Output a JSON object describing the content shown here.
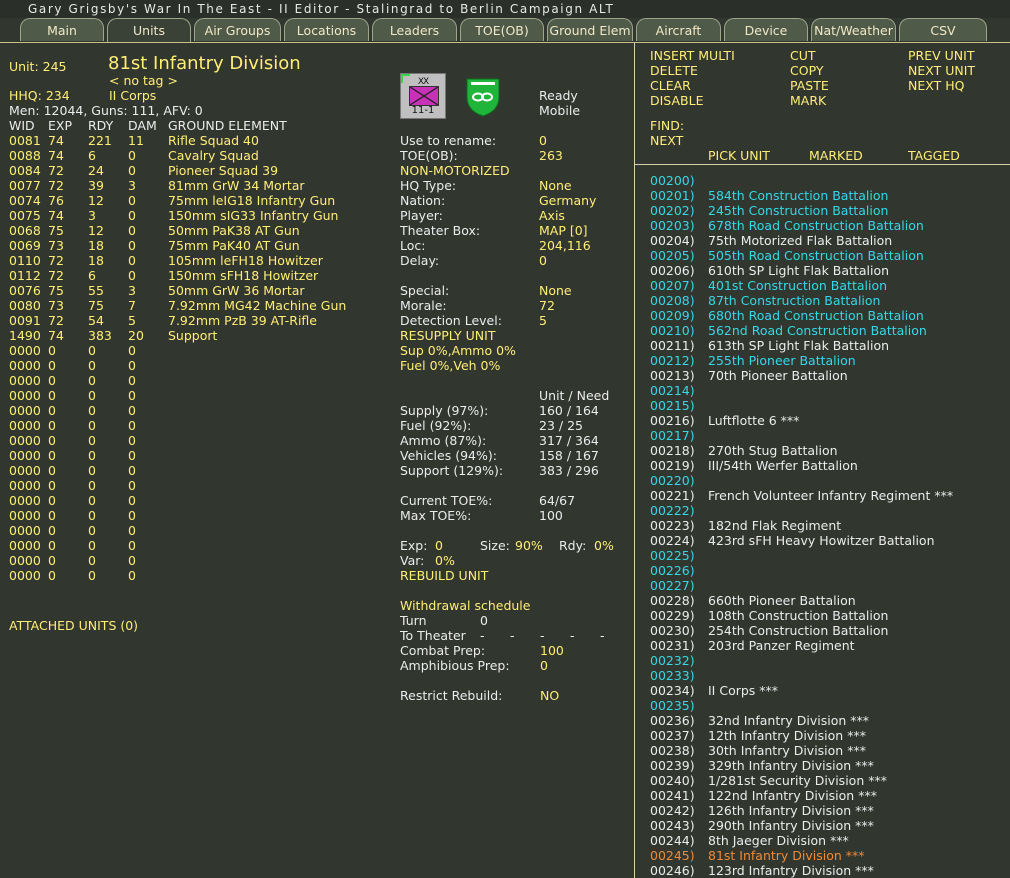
{
  "titlebar": "Gary Grigsby's War In The East - II Editor -  Stalingrad to Berlin Campaign ALT",
  "tabs": [
    "Main",
    "Units",
    "Air Groups",
    "Locations",
    "Leaders",
    "TOE(OB)",
    "Ground Elem",
    "Aircraft",
    "Device",
    "Nat/Weather",
    "CSV"
  ],
  "active_tab": "Units",
  "unit": {
    "unit_label": "Unit: 245",
    "name": "81st Infantry Division",
    "tag": "< no tag >",
    "hhq_label": "HHQ: 234",
    "hhq_name": "II Corps",
    "summary": "Men: 12044, Guns: 111, AFV: 0"
  },
  "elements_header": [
    "WID",
    "EXP",
    "RDY",
    "DAM",
    "GROUND ELEMENT"
  ],
  "elements": [
    [
      "0081",
      "74",
      "221",
      "11",
      "Rifle Squad 40"
    ],
    [
      "0088",
      "74",
      "6",
      "0",
      "Cavalry Squad"
    ],
    [
      "0084",
      "72",
      "24",
      "0",
      "Pioneer Squad 39"
    ],
    [
      "0077",
      "72",
      "39",
      "3",
      "81mm GrW 34 Mortar"
    ],
    [
      "0074",
      "76",
      "12",
      "0",
      "75mm leIG18 Infantry Gun"
    ],
    [
      "0075",
      "74",
      "3",
      "0",
      "150mm sIG33 Infantry Gun"
    ],
    [
      "0068",
      "75",
      "12",
      "0",
      "50mm PaK38 AT Gun"
    ],
    [
      "0069",
      "73",
      "18",
      "0",
      "75mm PaK40 AT Gun"
    ],
    [
      "0110",
      "72",
      "18",
      "0",
      "105mm leFH18 Howitzer"
    ],
    [
      "0112",
      "72",
      "6",
      "0",
      "150mm sFH18 Howitzer"
    ],
    [
      "0076",
      "75",
      "55",
      "3",
      "50mm GrW 36 Mortar"
    ],
    [
      "0080",
      "73",
      "75",
      "7",
      "7.92mm MG42 Machine Gun"
    ],
    [
      "0091",
      "72",
      "54",
      "5",
      "7.92mm PzB 39 AT-Rifle"
    ],
    [
      "1490",
      "74",
      "383",
      "20",
      "Support"
    ],
    [
      "0000",
      "0",
      "0",
      "0",
      ""
    ],
    [
      "0000",
      "0",
      "0",
      "0",
      ""
    ],
    [
      "0000",
      "0",
      "0",
      "0",
      ""
    ],
    [
      "0000",
      "0",
      "0",
      "0",
      ""
    ],
    [
      "0000",
      "0",
      "0",
      "0",
      ""
    ],
    [
      "0000",
      "0",
      "0",
      "0",
      ""
    ],
    [
      "0000",
      "0",
      "0",
      "0",
      ""
    ],
    [
      "0000",
      "0",
      "0",
      "0",
      ""
    ],
    [
      "0000",
      "0",
      "0",
      "0",
      ""
    ],
    [
      "0000",
      "0",
      "0",
      "0",
      ""
    ],
    [
      "0000",
      "0",
      "0",
      "0",
      ""
    ],
    [
      "0000",
      "0",
      "0",
      "0",
      ""
    ],
    [
      "0000",
      "0",
      "0",
      "0",
      ""
    ],
    [
      "0000",
      "0",
      "0",
      "0",
      ""
    ],
    [
      "0000",
      "0",
      "0",
      "0",
      ""
    ],
    [
      "0000",
      "0",
      "0",
      "0",
      ""
    ]
  ],
  "attached_units": "ATTACHED UNITS (0)",
  "counter": {
    "type": "XX",
    "number": "11-1"
  },
  "status": {
    "ready": "Ready",
    "mobile": "Mobile"
  },
  "props": [
    {
      "k": "Use to rename:",
      "v": "0"
    },
    {
      "k": "TOE(OB):",
      "v": "263"
    },
    {
      "k": "NON-MOTORIZED",
      "v": ""
    },
    {
      "k": "HQ Type:",
      "v": "None"
    },
    {
      "k": "Nation:",
      "v": "Germany"
    },
    {
      "k": "Player:",
      "v": "Axis"
    },
    {
      "k": "Theater Box:",
      "v": "MAP [0]"
    },
    {
      "k": "Loc:",
      "v": "204,116"
    },
    {
      "k": "Delay:",
      "v": "0"
    },
    {
      "k": "",
      "v": ""
    },
    {
      "k": "Special:",
      "v": "None"
    },
    {
      "k": "Morale:",
      "v": "72"
    },
    {
      "k": "Detection Level:",
      "v": "5"
    },
    {
      "k": "RESUPPLY UNIT",
      "v": ""
    },
    {
      "k": "Sup 0%,Ammo 0%",
      "v": ""
    },
    {
      "k": "Fuel 0%,Veh 0%",
      "v": ""
    }
  ],
  "supply_header": "Unit / Need",
  "supply": [
    {
      "k": "Supply (97%):",
      "v": "160 / 164"
    },
    {
      "k": "Fuel (92%):",
      "v": "23 / 25"
    },
    {
      "k": "Ammo (87%):",
      "v": "317 / 364"
    },
    {
      "k": "Vehicles (94%):",
      "v": "158 / 167"
    },
    {
      "k": "Support (129%):",
      "v": "383 / 296"
    }
  ],
  "toe": [
    {
      "k": "Current TOE%:",
      "v": "64/67"
    },
    {
      "k": "Max TOE%:",
      "v": "100"
    }
  ],
  "exp_line": {
    "exp_label": "Exp:",
    "exp": "0",
    "size_label": "Size:",
    "size": "90%",
    "rdy_label": "Rdy:",
    "rdy": "0%",
    "var_label": "Var:",
    "var": "0%"
  },
  "rebuild_unit": "REBUILD UNIT",
  "withdrawal": {
    "title": "Withdrawal schedule",
    "turn_label": "Turn",
    "turn": "0",
    "theater_label": "To Theater",
    "theater_dashes": [
      "-",
      "-",
      "-",
      "-",
      "-"
    ],
    "combat_label": "Combat Prep:",
    "combat": "100",
    "amph_label": "Amphibious Prep:",
    "amph": "0",
    "restrict_label": "Restrict Rebuild:",
    "restrict": "NO"
  },
  "commands": {
    "col1": [
      "INSERT MULTI",
      "DELETE",
      "CLEAR",
      "DISABLE"
    ],
    "col2": [
      "CUT",
      "COPY",
      "PASTE",
      "MARK"
    ],
    "col3": [
      "PREV UNIT",
      "NEXT UNIT",
      "NEXT HQ"
    ],
    "find": "FIND:",
    "next": "NEXT"
  },
  "list_headers": [
    "PICK UNIT",
    "MARKED",
    "TAGGED"
  ],
  "unit_list": [
    {
      "id": "00200)",
      "name": "",
      "c": "c"
    },
    {
      "id": "00201)",
      "name": "584th Construction Battalion",
      "c": "c"
    },
    {
      "id": "00202)",
      "name": "245th Construction Battalion",
      "c": "c"
    },
    {
      "id": "00203)",
      "name": "678th Road Construction Battalion",
      "c": "c"
    },
    {
      "id": "00204)",
      "name": "75th Motorized Flak Battalion",
      "c": "w"
    },
    {
      "id": "00205)",
      "name": "505th Road Construction Battalion",
      "c": "c"
    },
    {
      "id": "00206)",
      "name": "610th SP Light Flak Battalion",
      "c": "w"
    },
    {
      "id": "00207)",
      "name": "401st Construction Battalion",
      "c": "c"
    },
    {
      "id": "00208)",
      "name": "87th Construction Battalion",
      "c": "c"
    },
    {
      "id": "00209)",
      "name": "680th Road Construction Battalion",
      "c": "c"
    },
    {
      "id": "00210)",
      "name": "562nd Road Construction Battalion",
      "c": "c"
    },
    {
      "id": "00211)",
      "name": "613th SP Light Flak Battalion",
      "c": "w"
    },
    {
      "id": "00212)",
      "name": "255th Pioneer Battalion",
      "c": "c"
    },
    {
      "id": "00213)",
      "name": "70th Pioneer Battalion",
      "c": "w"
    },
    {
      "id": "00214)",
      "name": "",
      "c": "c"
    },
    {
      "id": "00215)",
      "name": "",
      "c": "c"
    },
    {
      "id": "00216)",
      "name": "Luftflotte 6  ***",
      "c": "w"
    },
    {
      "id": "00217)",
      "name": "",
      "c": "c"
    },
    {
      "id": "00218)",
      "name": "270th Stug Battalion",
      "c": "w"
    },
    {
      "id": "00219)",
      "name": "III/54th Werfer Battalion",
      "c": "w"
    },
    {
      "id": "00220)",
      "name": "",
      "c": "c"
    },
    {
      "id": "00221)",
      "name": "French Volunteer Infantry Regiment ***",
      "c": "w"
    },
    {
      "id": "00222)",
      "name": "",
      "c": "c"
    },
    {
      "id": "00223)",
      "name": "182nd Flak Regiment",
      "c": "w"
    },
    {
      "id": "00224)",
      "name": "423rd sFH Heavy Howitzer Battalion",
      "c": "w"
    },
    {
      "id": "00225)",
      "name": "",
      "c": "c"
    },
    {
      "id": "00226)",
      "name": "",
      "c": "c"
    },
    {
      "id": "00227)",
      "name": "",
      "c": "c"
    },
    {
      "id": "00228)",
      "name": "660th Pioneer Battalion",
      "c": "w"
    },
    {
      "id": "00229)",
      "name": "108th Construction Battalion",
      "c": "w"
    },
    {
      "id": "00230)",
      "name": "254th Construction Battalion",
      "c": "w"
    },
    {
      "id": "00231)",
      "name": "203rd Panzer Regiment",
      "c": "w"
    },
    {
      "id": "00232)",
      "name": "",
      "c": "c"
    },
    {
      "id": "00233)",
      "name": "",
      "c": "c"
    },
    {
      "id": "00234)",
      "name": "II Corps ***",
      "c": "w"
    },
    {
      "id": "00235)",
      "name": "",
      "c": "c"
    },
    {
      "id": "00236)",
      "name": "32nd Infantry Division ***",
      "c": "w"
    },
    {
      "id": "00237)",
      "name": "12th Infantry Division ***",
      "c": "w"
    },
    {
      "id": "00238)",
      "name": "30th Infantry Division ***",
      "c": "w"
    },
    {
      "id": "00239)",
      "name": "329th Infantry Division ***",
      "c": "w"
    },
    {
      "id": "00240)",
      "name": "1/281st Security Division ***",
      "c": "w"
    },
    {
      "id": "00241)",
      "name": "122nd Infantry Division ***",
      "c": "w"
    },
    {
      "id": "00242)",
      "name": "126th Infantry Division ***",
      "c": "w"
    },
    {
      "id": "00243)",
      "name": "290th Infantry Division ***",
      "c": "w"
    },
    {
      "id": "00244)",
      "name": "8th Jaeger Division ***",
      "c": "w"
    },
    {
      "id": "00245)",
      "name": "81st Infantry Division ***",
      "c": "o"
    },
    {
      "id": "00246)",
      "name": "123rd Infantry Division ***",
      "c": "w"
    }
  ],
  "colors": {
    "background": "#31362f",
    "yellow": "#ffee76",
    "cyan": "#34d8e6",
    "selected": "#f08a36",
    "tab": "#505a48"
  }
}
